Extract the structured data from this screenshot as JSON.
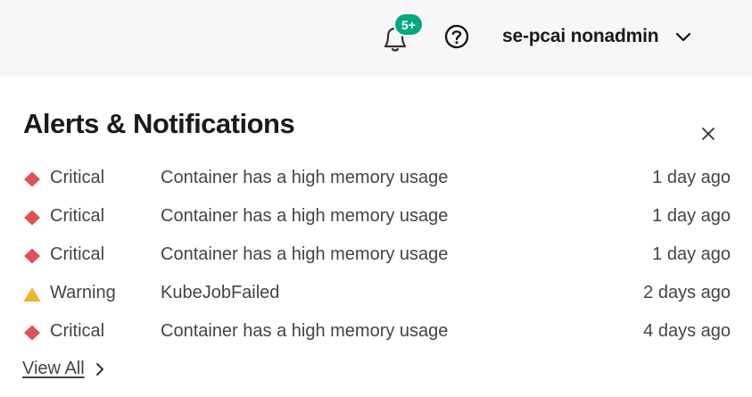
{
  "header": {
    "notifications_badge": "5+",
    "user_name": "se-pcai nonadmin"
  },
  "panel": {
    "title": "Alerts & Notifications",
    "alerts": [
      {
        "severity": "Critical",
        "message": "Container has a high memory usage",
        "time": "1 day ago"
      },
      {
        "severity": "Critical",
        "message": "Container has a high memory usage",
        "time": "1 day ago"
      },
      {
        "severity": "Critical",
        "message": "Container has a high memory usage",
        "time": "1 day ago"
      },
      {
        "severity": "Warning",
        "message": "KubeJobFailed",
        "time": "2 days ago"
      },
      {
        "severity": "Critical",
        "message": "Container has a high memory usage",
        "time": "4 days ago"
      }
    ],
    "view_all_label": "View All"
  },
  "colors": {
    "critical": "#e05252",
    "warning": "#f0b429",
    "badge": "#01a982"
  },
  "icons": {
    "bell": "bell-icon",
    "help": "help-icon",
    "chevron": "chevron-down-icon",
    "close": "close-icon",
    "critical": "diamond-icon",
    "warning": "triangle-icon",
    "view_all": "chevron-right-icon"
  }
}
